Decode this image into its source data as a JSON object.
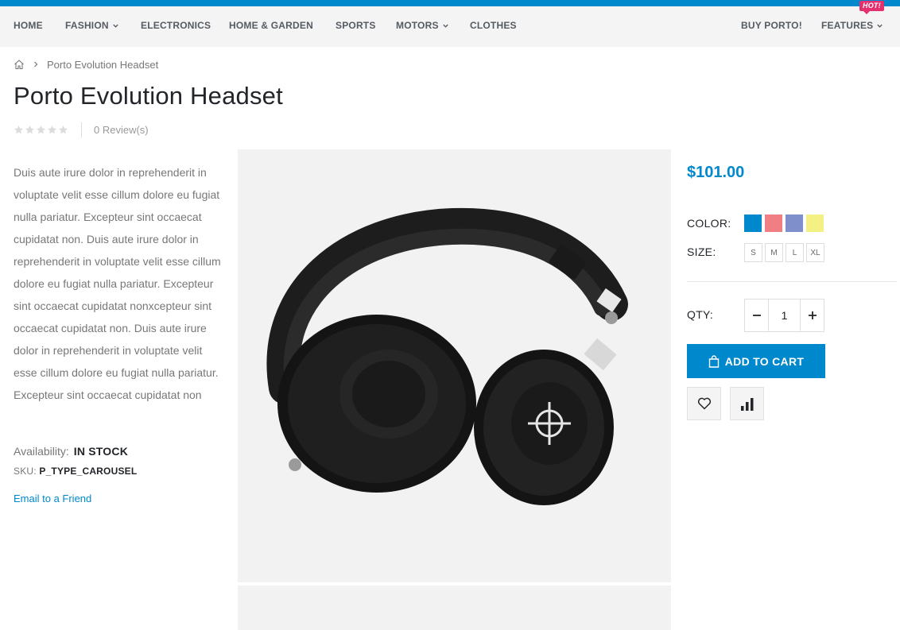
{
  "nav": {
    "items": [
      {
        "label": "HOME",
        "has_dropdown": false
      },
      {
        "label": "FASHION",
        "has_dropdown": true
      },
      {
        "label": "ELECTRONICS",
        "has_dropdown": false
      },
      {
        "label": "HOME & GARDEN",
        "has_dropdown": false
      },
      {
        "label": "SPORTS",
        "has_dropdown": false
      },
      {
        "label": "MOTORS",
        "has_dropdown": true
      },
      {
        "label": "CLOTHES",
        "has_dropdown": false
      }
    ],
    "right": [
      {
        "label": "BUY PORTO!",
        "has_dropdown": false
      },
      {
        "label": "FEATURES",
        "has_dropdown": true,
        "badge": "HOT!"
      }
    ]
  },
  "breadcrumb": {
    "home_icon": "home-icon",
    "current": "Porto Evolution Headset"
  },
  "product": {
    "title": "Porto Evolution Headset",
    "rating": 0,
    "reviews": "0 Review(s)",
    "description": "Duis aute irure dolor in reprehenderit in voluptate velit esse cillum dolore eu fugiat nulla pariatur. Excepteur sint occaecat cupidatat non. Duis aute irure dolor in reprehenderit in voluptate velit esse cillum dolore eu fugiat nulla pariatur. Excepteur sint occaecat cupidatat nonxcepteur sint occaecat cupidatat non. Duis aute irure dolor in reprehenderit in voluptate velit esse cillum dolore eu fugiat nulla pariatur. Excepteur sint occaecat cupidatat non",
    "availability_label": "Availability:",
    "availability_value": "IN STOCK",
    "sku_label": "SKU:",
    "sku_value": "P_TYPE_CAROUSEL",
    "email_link": "Email to a Friend",
    "price": "$101.00",
    "color_label": "COLOR:",
    "colors": [
      "#0088cc",
      "#f07f84",
      "#7f8fcc",
      "#f3f184"
    ],
    "size_label": "SIZE:",
    "sizes": [
      "S",
      "M",
      "L",
      "XL"
    ],
    "qty_label": "QTY:",
    "qty_value": "1",
    "add_to_cart": "ADD TO CART"
  },
  "colors": {
    "accent": "#0088cc",
    "hot_badge": "#e3306f",
    "nav_bg": "#f4f4f4",
    "gallery_bg": "#f2f2f2"
  }
}
